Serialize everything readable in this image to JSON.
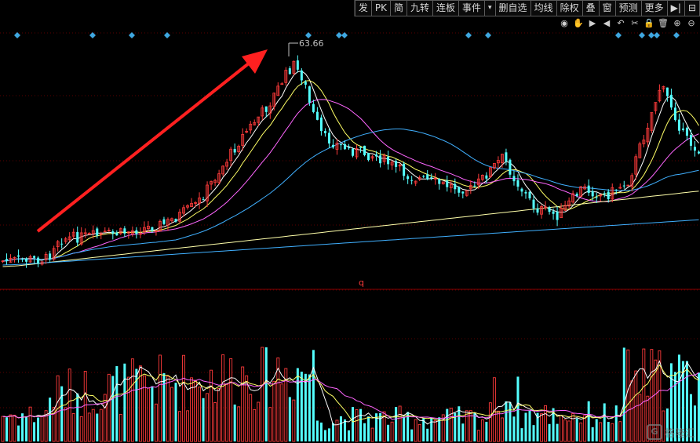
{
  "toolbar": {
    "buttons": [
      "发",
      "PK",
      "简",
      "九转",
      "连板",
      "事件",
      "▾",
      "删自选",
      "均线",
      "除权",
      "叠",
      "窗",
      "预测",
      "更多",
      "▶|",
      "⊟"
    ]
  },
  "chart_tools": {
    "icons": [
      "eye-icon",
      "hand-icon",
      "play-icon",
      "rewind-icon",
      "undo-icon",
      "scissors-icon",
      "lock-icon",
      "trash-icon",
      "zoom-in-icon",
      "zoom-out-icon"
    ]
  },
  "colors": {
    "up": "#ff3b3b",
    "down": "#54ffff",
    "ma5": "#ffffff",
    "ma10": "#ffff66",
    "ma20": "#ff66ff",
    "ma60": "#33cc33",
    "ma120": "#40b0ff",
    "ma250": "#ffffaa",
    "grid": "#5a0000",
    "arrow": "#ff2020",
    "marker": "#3fa7e0"
  },
  "price_panel": {
    "max_label": "63.66"
  },
  "volume_panel": {
    "label": "q"
  },
  "watermark": {
    "text": "格隆汇",
    "logo": "G"
  }
}
